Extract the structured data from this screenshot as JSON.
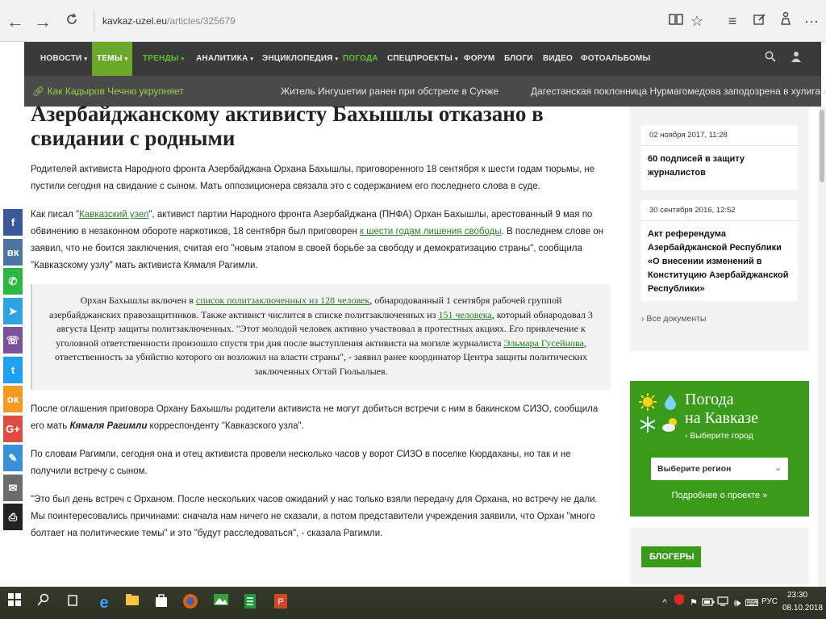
{
  "browser": {
    "url_host": "kavkaz-uzel.eu",
    "url_path": "/articles/325679",
    "icons": {
      "back": "back-arrow-icon",
      "forward": "forward-arrow-icon",
      "refresh": "refresh-icon",
      "reading_view": "book-icon",
      "favorite": "star-icon",
      "hub": "hub-icon",
      "notes": "pen-note-icon",
      "share": "share-icon",
      "more": "more-icon"
    }
  },
  "site_nav": {
    "items": [
      {
        "label": "НОВОСТИ",
        "caret": "▾"
      },
      {
        "label": "ТЕМЫ",
        "caret": "▾"
      },
      {
        "label": "ТРЕНДЫ",
        "caret": "▾"
      },
      {
        "label": "АНАЛИТИКА",
        "caret": "▾"
      },
      {
        "label": "ЭНЦИКЛОПЕДИЯ",
        "caret": "▾"
      },
      {
        "label": "ПОГОДА",
        "caret": ""
      },
      {
        "label": "СПЕЦПРОЕКТЫ",
        "caret": "▾"
      },
      {
        "label": "ФОРУМ",
        "caret": ""
      },
      {
        "label": "БЛОГИ",
        "caret": ""
      },
      {
        "label": "ВИДЕО",
        "caret": ""
      },
      {
        "label": "ФОТОАЛЬБОМЫ",
        "caret": ""
      }
    ]
  },
  "ticker": {
    "items": [
      "Как Кадыров Чечню укрупняет",
      "Житель Ингушетии ранен при обстреле в Сунже",
      "Дагестанская поклонница Нурмагомедова заподозрена в хулиганстве"
    ]
  },
  "article": {
    "title": "Азербайджанскому активисту Бахышлы отказано в свидании с родными",
    "lead": "Родителей активиста Народного фронта Азербайджана Орхана Бахышлы, приговоренного 18 сентября к шести годам тюрьмы, не пустили сегодня на свидание с сыном. Мать оппозиционера связала это с содержанием его последнего слова в суде.",
    "p2": {
      "t1": "Как писал \"",
      "link1": "Кавказский узел",
      "t2": "\", активист партии Народного фронта Азербайджана (ПНФА) Орхан Бахышлы, арестованный 9 мая по обвинению в незаконном обороте наркотиков, 18 сентября был приговорен ",
      "link2": "к шести годам лишения свободы",
      "t3": ". В последнем слове он заявил, что не боится заключения, считая его \"новым этапом в своей борьбе за свободу и демократизацию страны\", сообщила \"Кавказскому узлу\" мать активиста Кямаля Рагимли."
    },
    "quote": {
      "t1": "Орхан Бахышлы включен в ",
      "link1": "список политзаключенных из 128 человек",
      "t2": ", обнародованный 1 сентября рабочей группой азербайджанских правозащитников. Также активист числится в списке политзаключенных из ",
      "link2": "151 человека",
      "t3": ", который обнародовал 3 августа Центр защиты политзаключенных. \"Этот молодой человек активно участвовал в протестных акциях. Его привлечение к уголовной ответственности произошло спустя три дня после выступления активиста на могиле журналиста ",
      "link3": "Эльмара Гусейнова",
      "t4": ", ответственность за убийство которого он возложил на власти страны\", - заявил ранее координатор Центра защиты политических заключенных Огтай Гюльалыев."
    },
    "p3": {
      "t1": "После оглашения приговора Орхану Бахышлы родители активиста не могут добиться встречи с ним в бакинском СИЗО, сообщила его мать ",
      "name": "Кямаля Рагимли",
      "t2": " корреспонденту \"Кавказского узла\"."
    },
    "p4": "По словам Рагимли, сегодня она и отец активиста провели несколько часов у ворот СИЗО в поселке Кюрдаханы, но так и не получили встречу с сыном.",
    "p5": "\"Это был день встреч с Орханом. После нескольких часов ожиданий у нас только взяли передачу для Орхана, но встречу не дали. Мы поинтересовались причинами: сначала нам ничего не сказали, а потом представители учреждения заявили, что Орхан \"много болтает на политические темы\" и это \"будут расследоваться\", - сказала Рагимли."
  },
  "share_bar": {
    "items": [
      {
        "icon": "facebook-icon",
        "glyph": "f",
        "color": "#3b5998"
      },
      {
        "icon": "vk-icon",
        "glyph": "вк",
        "color": "#4c75a3"
      },
      {
        "icon": "whatsapp-icon",
        "glyph": "✆",
        "color": "#2cb742"
      },
      {
        "icon": "telegram-icon",
        "glyph": "➤",
        "color": "#2ca5e0"
      },
      {
        "icon": "viber-icon",
        "glyph": "☏",
        "color": "#7b519d"
      },
      {
        "icon": "twitter-icon",
        "glyph": "t",
        "color": "#1da1f2"
      },
      {
        "icon": "odnoklassniki-icon",
        "glyph": "ок",
        "color": "#f59a20"
      },
      {
        "icon": "googleplus-icon",
        "glyph": "G+",
        "color": "#dc4e41"
      },
      {
        "icon": "livejournal-icon",
        "glyph": "✎",
        "color": "#3a8fd9"
      },
      {
        "icon": "email-icon",
        "glyph": "✉",
        "color": "#6c6c6c"
      },
      {
        "icon": "print-icon",
        "glyph": "⎙",
        "color": "#222222"
      }
    ]
  },
  "sidebar": {
    "docs": [
      {
        "date": "02 ноября 2017, 11:28",
        "title": "60 подписей в защиту журналистов"
      },
      {
        "date": "30 сентября 2016, 12:52",
        "title": "Акт референдума Азербайджанской Республики «О внесении изменений в Конституцию Азербайджанской Республики»"
      }
    ],
    "all_docs": "Все документы",
    "weather": {
      "title_line1": "Погода",
      "title_line2": "на Кавказе",
      "subtitle": "Выберите город",
      "select_value": "Выберите регион",
      "more": "Подробнее о проекте »"
    },
    "bloggers": "БЛОГЕРЫ"
  },
  "taskbar": {
    "time": "23:30",
    "date": "08.10.2018",
    "lang": "РУС"
  },
  "colors": {
    "accent_green": "#3a9a1a",
    "nav_bg": "#3a3a3a",
    "link_green": "#2a7a2a"
  }
}
